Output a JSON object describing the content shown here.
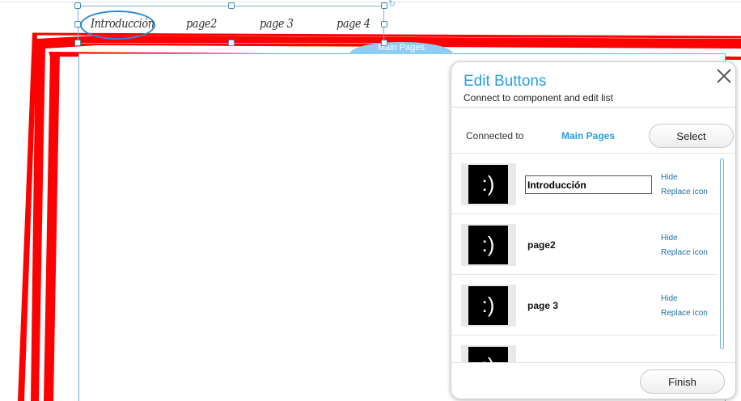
{
  "canvas": {
    "tab_label": "Main Pages",
    "menu_items": [
      "Introducción",
      "page2",
      "page 3",
      "page 4"
    ],
    "frame_color": "#ff0000",
    "selection_color": "#5cb6e3"
  },
  "panel": {
    "title": "Edit Buttons",
    "subtitle": "Connect to component and edit list",
    "connected_label": "Connected to",
    "connected_value": "Main Pages",
    "select_label": "Select",
    "finish_label": "Finish",
    "accent_color": "#2a9ee0",
    "items": [
      {
        "icon_text": ":)",
        "name": "Introducción",
        "hide": "Hide",
        "replace": "Replace icon",
        "editing": true
      },
      {
        "icon_text": ":)",
        "name": "page2",
        "hide": "Hide",
        "replace": "Replace icon",
        "editing": false
      },
      {
        "icon_text": ":)",
        "name": "page 3",
        "hide": "Hide",
        "replace": "Replace icon",
        "editing": false
      },
      {
        "icon_text": ":)",
        "name": "",
        "hide": "",
        "replace": "",
        "editing": false
      }
    ]
  },
  "icons": {
    "close": "close-icon",
    "rotate": "rotate-icon"
  }
}
